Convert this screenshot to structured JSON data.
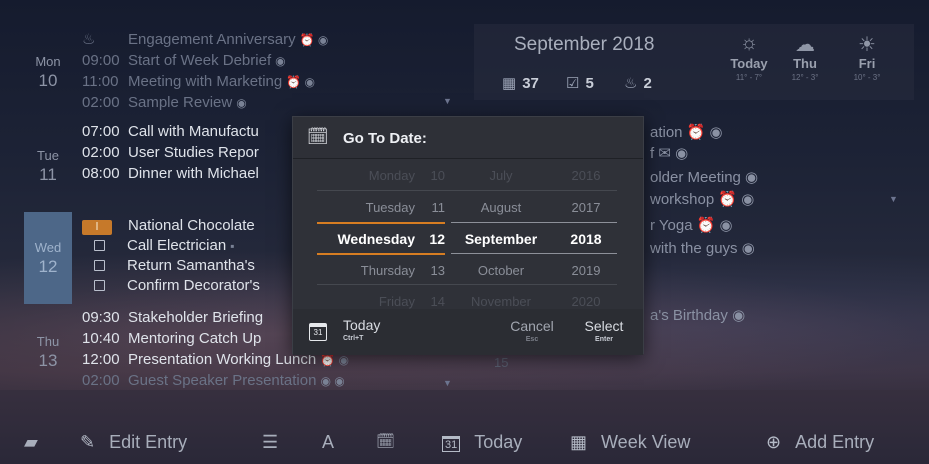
{
  "days": [
    {
      "weekday": "Mon",
      "date": "10",
      "events": [
        {
          "time": "",
          "kind": "anniversary",
          "title": "Engagement Anniversary",
          "icons": "⏰ ◉",
          "dim": true
        },
        {
          "time": "09:00",
          "title": "Start of Week Debrief",
          "icons": "◉",
          "dim": true
        },
        {
          "time": "11:00",
          "title": "Meeting with Marketing",
          "icons": "⏰ ◉",
          "dim": true
        },
        {
          "time": "02:00",
          "title": "Sample Review",
          "icons": "◉",
          "dim": true
        }
      ]
    },
    {
      "weekday": "Tue",
      "date": "11",
      "events": [
        {
          "time": "07:00",
          "title": "Call with Manufactu"
        },
        {
          "time": "02:00",
          "title": "User Studies Repor"
        },
        {
          "time": "08:00",
          "title": "Dinner with Michael"
        }
      ]
    },
    {
      "weekday": "Wed",
      "date": "12",
      "events": [
        {
          "kind": "flag",
          "title": "National Chocolate"
        },
        {
          "kind": "task",
          "title": "Call Electrician",
          "icons": "▪"
        },
        {
          "kind": "task",
          "title": "Return Samantha's"
        },
        {
          "kind": "task",
          "title": "Confirm Decorator's"
        }
      ]
    },
    {
      "weekday": "Thu",
      "date": "13",
      "events": [
        {
          "time": "09:30",
          "title": "Stakeholder Briefing"
        },
        {
          "time": "10:40",
          "title": "Mentoring Catch Up"
        },
        {
          "time": "12:00",
          "title": "Presentation Working Lunch",
          "icons": "⏰ ◉"
        },
        {
          "time": "02:00",
          "title": "Guest Speaker Presentation",
          "icons": "◉ ◉",
          "dim": true
        }
      ]
    }
  ],
  "month_panel": {
    "title": "September 2018",
    "stats": [
      {
        "icon": "calendar-icon",
        "glyph": "▦",
        "value": "37"
      },
      {
        "icon": "checkbox-icon",
        "glyph": "☑",
        "value": "5"
      },
      {
        "icon": "cake-icon",
        "glyph": "♨",
        "value": "2"
      }
    ],
    "weather": [
      {
        "day": "Today",
        "temp": "11° - 7°",
        "glyph": "☼"
      },
      {
        "day": "Thu",
        "temp": "12° - 3°",
        "glyph": "☁"
      },
      {
        "day": "Fri",
        "temp": "10° - 3°",
        "glyph": "☀"
      }
    ]
  },
  "right_events": [
    {
      "text": "ation ⏰ ◉"
    },
    {
      "text": "f ✉ ◉"
    },
    {
      "text": "older Meeting ◉"
    },
    {
      "text": "workshop ⏰ ◉"
    },
    {
      "text": "r Yoga ⏰ ◉"
    },
    {
      "text": "with the guys ◉"
    },
    {
      "text": "a's Birthday ◉"
    },
    {
      "text": "15"
    }
  ],
  "dialog": {
    "title": "Go To Date:",
    "weekdays": [
      "Monday",
      "Tuesday",
      "Wednesday",
      "Thursday",
      "Friday"
    ],
    "days": [
      "10",
      "11",
      "12",
      "13",
      "14"
    ],
    "months": [
      "July",
      "August",
      "September",
      "October",
      "November"
    ],
    "years": [
      "2016",
      "2017",
      "2018",
      "2019",
      "2020"
    ],
    "today_label": "Today",
    "today_shortcut": "Ctrl+T",
    "cancel_label": "Cancel",
    "cancel_shortcut": "Esc",
    "select_label": "Select",
    "select_shortcut": "Enter",
    "today_icon_day": "31"
  },
  "toolbar": {
    "edit_label": "Edit Entry",
    "today_label": "Today",
    "week_label": "Week View",
    "add_label": "Add Entry",
    "today_icon_day": "31",
    "font_glyph": "A"
  },
  "colors": {
    "accent": "#d67d22",
    "selected_day": "#4d6788"
  }
}
